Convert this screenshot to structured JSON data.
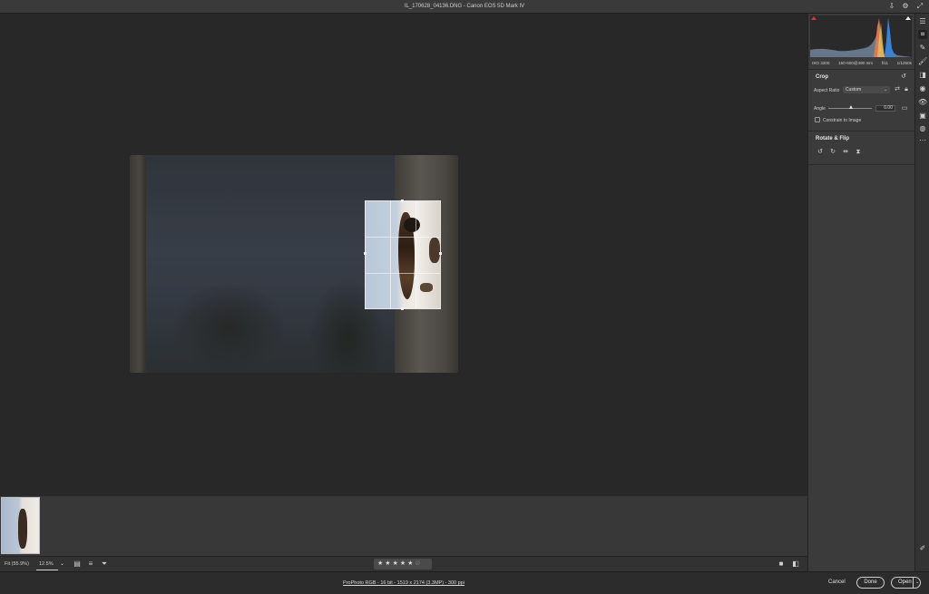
{
  "window": {
    "title": "IL_170628_04136.DNG  -  Canon EOS 5D Mark IV",
    "icons": [
      "save-icon",
      "gear-icon",
      "expand-icon"
    ]
  },
  "histogram": {
    "iso": "ISO 3200",
    "lens": "150-600@490 mm",
    "aperture": "f/11",
    "shutter": "1/1250s"
  },
  "crop_panel": {
    "title": "Crop",
    "aspect_ratio_label": "Aspect Ratio",
    "aspect_ratio_value": "Custom",
    "angle_label": "Angle",
    "angle_value": "0.00",
    "angle_level": 0.5,
    "constrain_label": "Constrain to Image",
    "constrain_checked": false
  },
  "rotate_panel": {
    "title": "Rotate & Flip",
    "icons": [
      "rotate-left-icon",
      "rotate-right-icon",
      "flip-horizontal-icon",
      "flip-vertical-icon"
    ]
  },
  "bottombar": {
    "fit_label": "Fit (55.9%)",
    "zoom_value": "12.5%",
    "rating_stars": 5,
    "icons": [
      "filmstrip-view-icon",
      "sort-icon",
      "filter-icon"
    ]
  },
  "status": {
    "workflow_link": "ProPhoto RGB - 16 bit - 1519 x 2174 (3.3MP) - 300 ppi",
    "cancel_label": "Cancel",
    "done_label": "Done",
    "open_label": "Open"
  },
  "colors": {
    "panel_bg": "#3b3b3b",
    "canvas_bg": "#282828",
    "accent_red": "#dd3333"
  }
}
